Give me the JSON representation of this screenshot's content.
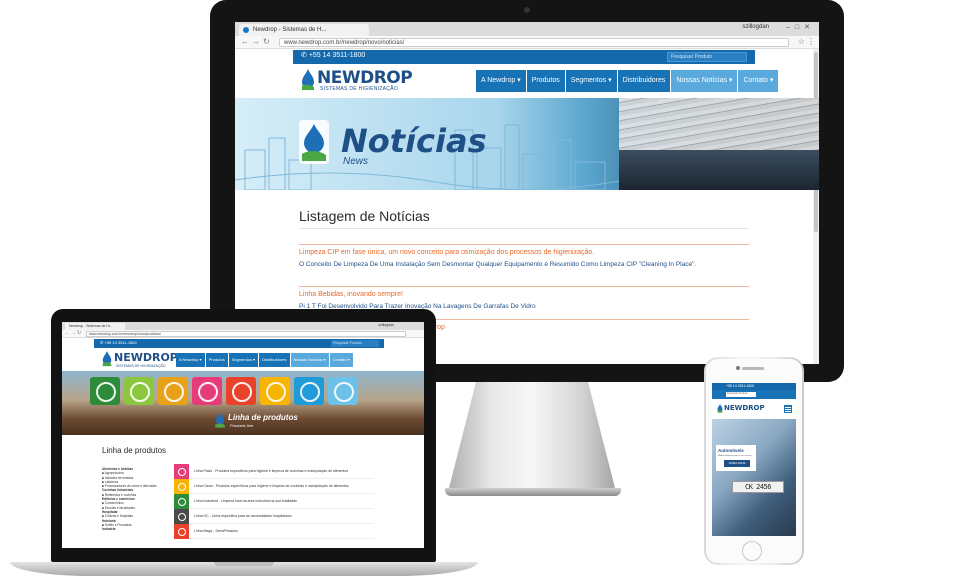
{
  "imac": {
    "browser": {
      "tab_title": "Newdrop - Sistemas de H...",
      "user_name": "szillogdan",
      "url": "www.newdrop.com.br/newdrop/novo/noticias/"
    },
    "site": {
      "phone": "+55 14 3511-1800",
      "search_placeholder": "Pesquisar Produto",
      "logo": {
        "name": "NEWDROP",
        "tagline": "SISTEMAS DE HIGIENIZAÇÃO"
      },
      "nav": [
        "A Newdrop ▾",
        "Produtos",
        "Segmentos ▾",
        "Distribuidores",
        "Nossas Notícias ▾",
        "Contato ▾"
      ],
      "hero": {
        "title": "Notícias",
        "subtitle": "News"
      },
      "page_title": "Listagem de Notícias",
      "news": [
        {
          "title": "Limpeza CIP em fase única, um novo conceito para otimização dos processos de higienização.",
          "description": "O Conceito De Limpeza De Uma Instalação Sem Desmontar Qualquer Equipamento é Resumido Como Limpeza CIP \"Cleaning In Place\"."
        },
        {
          "title": "Linha Bebidas, inovando sempre!",
          "description": "Pi 1 T Foi Desenvolvido Para Trazer Inovação Na Lavagens De Garrafas De Vidro"
        },
        {
          "title": "...rop",
          "description": ""
        }
      ]
    }
  },
  "macbook": {
    "browser": {
      "tab_title": "Newdrop - Sistemas de Hi...",
      "user_name": "szillogdan",
      "url": "www.newdrop.com.br/newdrop/novo/produtos/"
    },
    "site": {
      "phone": "+55 14 3511-1800",
      "search_placeholder": "Pesquisar Produto",
      "logo": {
        "name": "NEWDROP",
        "tagline": "SISTEMAS DE HIGIENIZAÇÃO"
      },
      "nav": [
        "A Newdrop ▾",
        "Produtos",
        "Segmentos ▾",
        "Distribuidores",
        "Nossas Notícias ▾",
        "Contato ▾"
      ],
      "hero": {
        "title": "Linha de produtos",
        "subtitle": "Products line"
      },
      "tile_colors": [
        "#2e8b3a",
        "#8cc63f",
        "#e8a21a",
        "#e63c7a",
        "#e8432a",
        "#f7b500",
        "#1f9bd7",
        "#6bc1e8"
      ],
      "page_title": "Linha de produtos",
      "categories": [
        {
          "label": "Alimentos e bebidas",
          "heading": true
        },
        {
          "label": "Agropecuária",
          "heading": false
        },
        {
          "label": "Indústria de bebidas",
          "heading": false
        },
        {
          "label": "Laticínios",
          "heading": false
        },
        {
          "label": "Processadores de carne e derivados",
          "heading": false
        },
        {
          "label": "Cozinhas Industriais",
          "heading": true
        },
        {
          "label": "Refeitórios e cozinhas",
          "heading": false
        },
        {
          "label": "Edifícios e comércios",
          "heading": true
        },
        {
          "label": "Condomínios",
          "heading": false
        },
        {
          "label": "Escolas e faculdades",
          "heading": false
        },
        {
          "label": "Hospitalar",
          "heading": true
        },
        {
          "label": "Clínicas e Hospitais",
          "heading": false
        },
        {
          "label": "Hotelaria",
          "heading": true
        },
        {
          "label": "Hotéis e Pousadas",
          "heading": false
        },
        {
          "label": "Indústria",
          "heading": true
        }
      ],
      "product_lines": [
        {
          "color": "#e63c7a",
          "text": "Linha Flash - Produtos específicos para higiene e limpeza de cozinhas e manipulação de alimentos"
        },
        {
          "color": "#f7b500",
          "text": "Linha Clean - Produtos específicos para higiene e limpeza de cozinhas e manipulação de alimentos"
        },
        {
          "color": "#2e8b3a",
          "text": "Linha Industrial - Limpeza total da área industrial na sua totalidade"
        },
        {
          "color": "#4a4a4a",
          "text": "Linha HC - Linha específica para as necessidades hospitalares"
        },
        {
          "color": "#e8432a",
          "text": "Linha Mega - Semi/Pesados"
        }
      ]
    }
  },
  "iphone": {
    "site": {
      "phone": "+55 14 3511-1800",
      "search_placeholder": "Pesquisar Produto",
      "logo": {
        "name": "NEWDROP"
      },
      "card": {
        "title": "Automóveis",
        "text": "Melhor limpeza para o seu veículo",
        "button": "SAIBA MAIS"
      },
      "plate": "CK 2456"
    }
  }
}
